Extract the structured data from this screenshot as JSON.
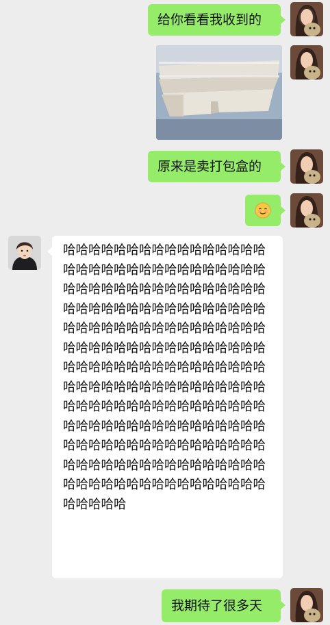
{
  "messages": [
    {
      "side": "right",
      "type": "text",
      "text": "给你看看我收到的"
    },
    {
      "side": "right",
      "type": "image",
      "alt_icon": "photo-takeout-boxes"
    },
    {
      "side": "right",
      "type": "text",
      "text": "原来是卖打包盒的"
    },
    {
      "side": "right",
      "type": "emoji",
      "emoji": "smiling-face-emoji"
    },
    {
      "side": "left",
      "type": "text",
      "text": "哈哈哈哈哈哈哈哈哈哈哈哈哈哈哈哈哈哈哈哈哈哈哈哈哈哈哈哈哈哈哈哈哈哈哈哈哈哈哈哈哈哈哈哈哈哈哈哈哈哈哈哈哈哈哈哈哈哈哈哈哈哈哈哈哈哈哈哈哈哈哈哈哈哈哈哈哈哈哈哈哈哈哈哈哈哈哈哈哈哈哈哈哈哈哈哈哈哈哈哈哈哈哈哈哈哈哈哈哈哈哈哈哈哈哈哈哈哈哈哈哈哈哈哈哈哈哈哈哈哈哈哈哈哈哈哈哈哈哈哈哈哈哈哈哈哈哈哈哈哈哈哈哈哈哈哈哈哈哈哈哈哈哈哈哈哈哈哈哈哈哈哈哈哈哈哈哈哈哈哈哈哈哈哈哈哈哈哈哈哈哈哈哈哈哈哈哈哈哈哈哈哈哈哈哈哈哈哈哈哈哈哈哈"
    },
    {
      "side": "right",
      "type": "text",
      "text": "我期待了很多天"
    }
  ],
  "avatars": {
    "self": "avatar-girl-with-dog",
    "other": "avatar-young-man"
  },
  "colors": {
    "background": "#ededed",
    "bubble_self": "#95ec69",
    "bubble_other": "#ffffff"
  }
}
